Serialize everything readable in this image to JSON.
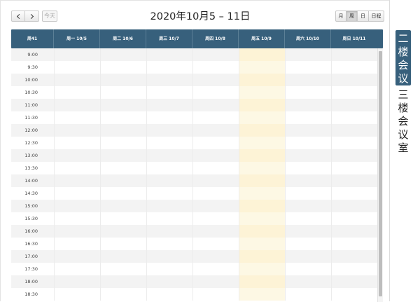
{
  "toolbar": {
    "prev_icon": "chevron-left-icon",
    "next_icon": "chevron-right-icon",
    "today_label": "今天",
    "title": "2020年10月5 – 11日",
    "views": [
      {
        "label": "月",
        "active": false
      },
      {
        "label": "周",
        "active": true
      },
      {
        "label": "日",
        "active": false
      },
      {
        "label": "日程",
        "active": false
      }
    ]
  },
  "header": {
    "first": "周41",
    "days": [
      "周一 10/5",
      "周二 10/6",
      "周三 10/7",
      "周四 10/8",
      "周五 10/9",
      "周六 10/10",
      "周日 10/11"
    ],
    "today_index": 4
  },
  "times": [
    "9:00",
    "9:30",
    "10:00",
    "10:30",
    "11:00",
    "11:30",
    "12:00",
    "12:30",
    "13:00",
    "13:30",
    "14:00",
    "14:30",
    "15:00",
    "15:30",
    "16:00",
    "16:30",
    "17:00",
    "17:30",
    "18:00",
    "18:30"
  ],
  "rooms": [
    {
      "label": "二楼会议室",
      "active": true
    },
    {
      "label": "三楼会议室",
      "active": false
    }
  ],
  "colors": {
    "header_bg": "#37607c",
    "today_bg": "#fdf8e4",
    "row_shade": "#f3f3f3"
  }
}
